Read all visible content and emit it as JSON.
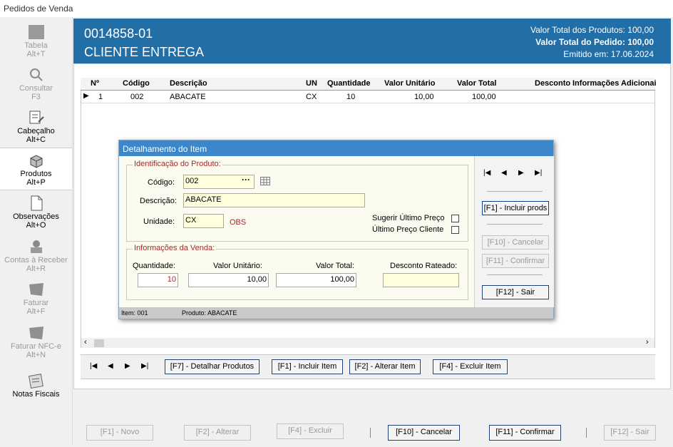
{
  "window": {
    "title": "Pedidos de Venda"
  },
  "sidebar": {
    "items": [
      {
        "label1": "Tabela",
        "label2": "Alt+T",
        "disabled": true,
        "icon": "table-icon"
      },
      {
        "label1": "Consultar",
        "label2": "F3",
        "disabled": true,
        "icon": "search-icon"
      },
      {
        "label1": "Cabeçalho",
        "label2": "Alt+C",
        "disabled": false,
        "icon": "document-edit-icon"
      },
      {
        "label1": "Produtos",
        "label2": "Alt+P",
        "disabled": false,
        "icon": "products-box-icon"
      },
      {
        "label1": "Observações",
        "label2": "Alt+O",
        "disabled": false,
        "icon": "blank-page-icon"
      },
      {
        "label1": "Contas à Receber",
        "label2": "Alt+R",
        "disabled": true,
        "icon": "money-stack-icon"
      },
      {
        "label1": "Faturar",
        "label2": "Alt+F",
        "disabled": true,
        "icon": "invoice-icon"
      },
      {
        "label1": "Faturar NFC-e",
        "label2": "Alt+N",
        "disabled": true,
        "icon": "nfce-icon"
      },
      {
        "label1": "Notas Fiscais",
        "label2": "",
        "disabled": false,
        "icon": "notes-icon"
      }
    ]
  },
  "header": {
    "order_number": "0014858-01",
    "client": "CLIENTE ENTREGA",
    "total_products": "Valor Total dos Produtos: 100,00",
    "total_order": "Valor Total do Pedido: 100,00",
    "issued": "Emitido em: 17.06.2024"
  },
  "grid": {
    "columns": [
      "Nº",
      "Código",
      "Descrição",
      "UN",
      "Quantidade",
      "Valor Unitário",
      "Valor Total",
      "Desconto",
      "Informações Adicionai"
    ],
    "rows": [
      {
        "n": "1",
        "code": "002",
        "desc": "ABACATE",
        "un": "CX",
        "qty": "10",
        "unit": "10,00",
        "total": "100,00"
      }
    ]
  },
  "nav": {
    "detail": "[F7] - Detalhar Produtos",
    "include": "[F1] - Incluir Item",
    "alter": "[F2] - Alterar Item",
    "delete": "[F4] - Excluir  Item"
  },
  "dialog": {
    "title": "Detalhamento do Item",
    "group_product": "Identificação do Produto:",
    "code_label": "Código:",
    "code_value": "002",
    "desc_label": "Descrição:",
    "desc_value": "ABACATE",
    "unit_label": "Unidade:",
    "unit_value": "CX",
    "obs": "OBS",
    "suggest_price": "Sugerir Último Preço",
    "last_price_client": "Último Preço Cliente",
    "group_sale": "Informações da Venda:",
    "qty_label": "Quantidade:",
    "qty_value": "10",
    "unit_price_label": "Valor Unitário:",
    "unit_price_value": "10,00",
    "total_label": "Valor Total:",
    "total_value": "100,00",
    "discount_label": "Desconto Rateado:",
    "discount_value": "",
    "btn_include": "[F1] - Incluir prods",
    "btn_cancel": "[F10] - Cancelar",
    "btn_confirm": "[F11] - Confirmar",
    "btn_exit": "[F12] - Sair",
    "status_item": "Item: 001",
    "status_product": "Produto: ABACATE"
  },
  "footer": {
    "new": "[F1] - Novo",
    "alter": "[F2] - Alterar",
    "delete": "[F4] - Excluir",
    "cancel": "[F10] - Cancelar",
    "confirm": "[F11] - Confirmar",
    "exit": "[F12] - Sair"
  }
}
